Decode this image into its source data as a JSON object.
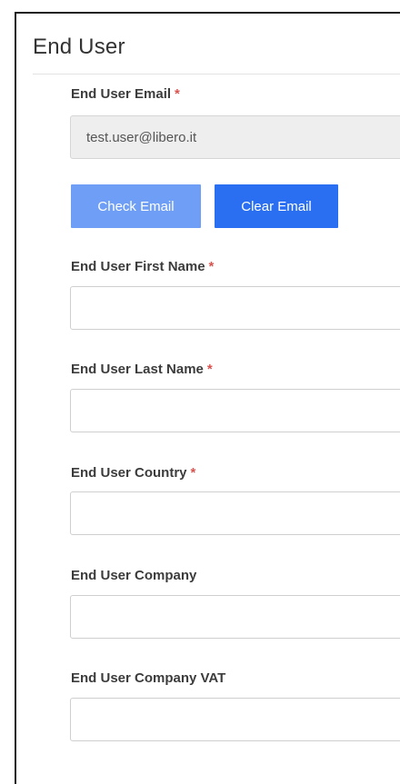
{
  "section": {
    "title": "End User"
  },
  "required_marker": "*",
  "email": {
    "label": "End User Email",
    "value": "test.user@libero.it",
    "required": true
  },
  "buttons": {
    "check_email": "Check Email",
    "clear_email": "Clear Email"
  },
  "fields": {
    "first_name": {
      "label": "End User First Name",
      "value": ""
    },
    "last_name": {
      "label": "End User Last Name",
      "value": ""
    },
    "country": {
      "label": "End User Country",
      "value": ""
    },
    "company": {
      "label": "End User Company",
      "value": ""
    },
    "company_vat": {
      "label": "End User Company VAT",
      "value": ""
    }
  },
  "colors": {
    "check_button": "#6e9ef5",
    "clear_button": "#2a6ff2",
    "required_asterisk": "#d9534f"
  }
}
